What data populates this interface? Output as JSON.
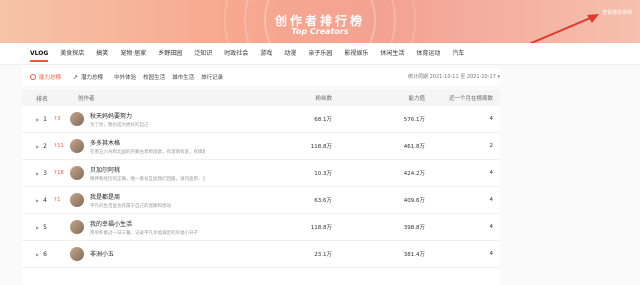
{
  "banner": {
    "title": "创作者排行榜",
    "subtitle": "Top Creators",
    "link_text": "查看榜单说明"
  },
  "categories": [
    "VLOG",
    "美食探店",
    "搞笑",
    "宠物·居家",
    "乡野田园",
    "泛知识",
    "时政社会",
    "游戏",
    "动漫",
    "亲子乐园",
    "影视娱乐",
    "休闲生活",
    "体育运动",
    "汽车"
  ],
  "subbar": {
    "ability": "能力总榜",
    "potential": "潜力总榜",
    "tabs": [
      "中外体验",
      "校园生活",
      "城市生活",
      "旅行记录"
    ],
    "stat_date": "统计周期    2021-10-11 至 2021-10-17 ▾"
  },
  "table": {
    "headers": {
      "rank": "排名",
      "creator": "创作者",
      "fans": "粉丝数",
      "power": "能力值",
      "count": "近一个月在榜周数"
    },
    "rows": [
      {
        "rank": "1",
        "change": "↑3",
        "name": "秋天妈妈要努力",
        "desc": "为了你，我也成为更好的自己",
        "fans": "68.1万",
        "power": "576.1万",
        "count": "4"
      },
      {
        "rank": "2",
        "change": "↑11",
        "name": "多多其木格",
        "desc": "在南五六州和北国的内蒙古草原放歌，有温情有爱，有情趣",
        "fans": "118.8万",
        "power": "461.8万",
        "count": "2"
      },
      {
        "rank": "3",
        "change": "↑18",
        "name": "贝加尔阿桃",
        "desc": "精神和经历的正确，唯一看号互加我们回搬，请勿盗用，违者必究",
        "fans": "10.3万",
        "power": "424.2万",
        "count": "4"
      },
      {
        "rank": "4",
        "change": "↑1",
        "name": "我是都是周",
        "desc": "平凡的生活里也有属于自己的温暖和感动",
        "fans": "63.6万",
        "power": "409.6万",
        "count": "4"
      },
      {
        "rank": "5",
        "change": "",
        "name": "我的幸福小生活",
        "desc": "简单朴素过一日三餐，记录平凡幸福满足的幸福小日子",
        "fans": "118.8万",
        "power": "398.8万",
        "count": "4"
      },
      {
        "rank": "6",
        "change": "",
        "name": "非洲小五",
        "desc": "",
        "fans": "23.1万",
        "power": "381.4万",
        "count": "4"
      }
    ]
  }
}
